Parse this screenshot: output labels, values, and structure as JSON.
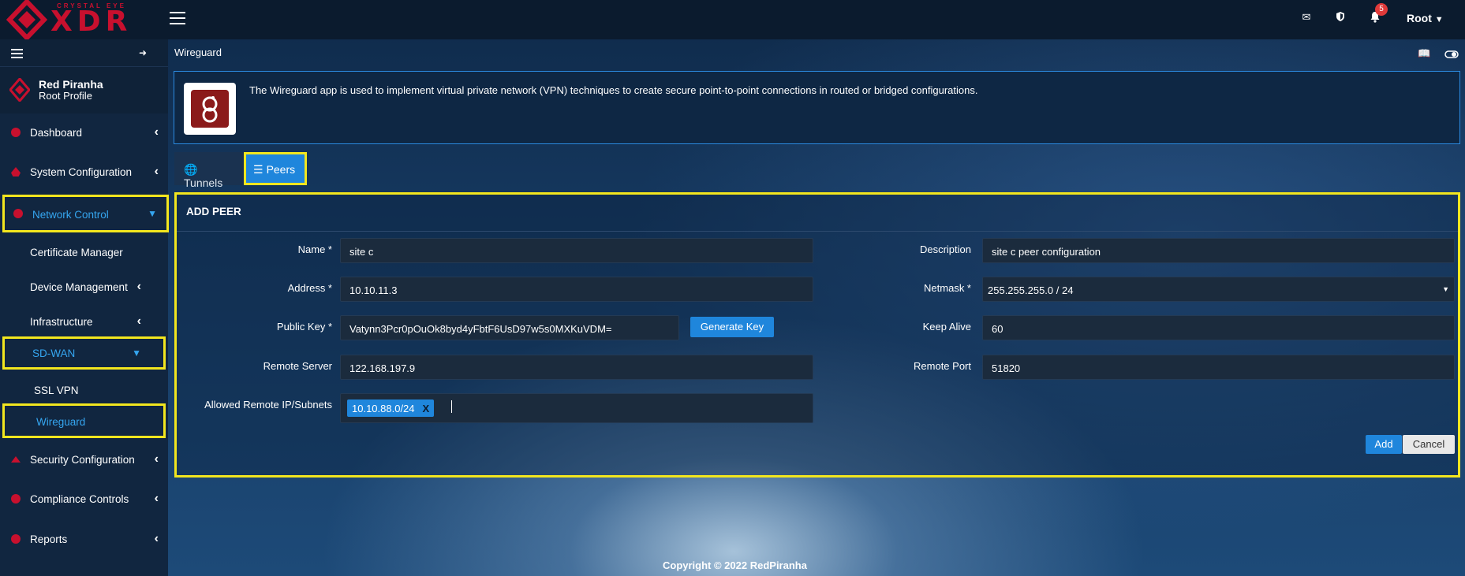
{
  "brand": {
    "top": "CRYSTAL EYE",
    "main": "XDR"
  },
  "header": {
    "notifications_count": "5",
    "user": "Root"
  },
  "profile": {
    "name": "Red Piranha",
    "role": "Root Profile"
  },
  "sidebar": {
    "items": [
      {
        "label": "Dashboard"
      },
      {
        "label": "System Configuration"
      },
      {
        "label": "Network Control"
      },
      {
        "label": "Certificate Manager"
      },
      {
        "label": "Device Management"
      },
      {
        "label": "Infrastructure"
      },
      {
        "label": "SD-WAN"
      },
      {
        "label": "SSL VPN"
      },
      {
        "label": "Wireguard"
      },
      {
        "label": "Security Configuration"
      },
      {
        "label": "Compliance Controls"
      },
      {
        "label": "Reports"
      }
    ]
  },
  "page": {
    "breadcrumb": "Wireguard",
    "info": "The Wireguard app is used to implement virtual private network (VPN) techniques to create secure point-to-point connections in routed or bridged configurations."
  },
  "tabs": [
    {
      "label": "Tunnels"
    },
    {
      "label": "Peers"
    }
  ],
  "form": {
    "title": "ADD PEER",
    "name": {
      "label": "Name *",
      "value": "site c"
    },
    "address": {
      "label": "Address *",
      "value": "10.10.11.3"
    },
    "public_key": {
      "label": "Public Key *",
      "value": "Vatynn3Pcr0pOuOk8byd4yFbtF6UsD97w5s0MXKuVDM="
    },
    "generate_key": "Generate Key",
    "remote_server": {
      "label": "Remote Server",
      "value": "122.168.197.9"
    },
    "allowed": {
      "label": "Allowed Remote IP/Subnets",
      "tag": "10.10.88.0/24",
      "tag_remove": "X"
    },
    "description": {
      "label": "Description",
      "value": "site c peer configuration"
    },
    "netmask": {
      "label": "Netmask *",
      "value": "255.255.255.0 / 24"
    },
    "keep_alive": {
      "label": "Keep Alive",
      "value": "60"
    },
    "remote_port": {
      "label": "Remote Port",
      "value": "51820"
    },
    "add": "Add",
    "cancel": "Cancel"
  },
  "footer": "Copyright © 2022 RedPiranha",
  "colors": {
    "accent": "#1f86dc",
    "highlight": "#f2e61e",
    "brand_red": "#c8102e"
  }
}
